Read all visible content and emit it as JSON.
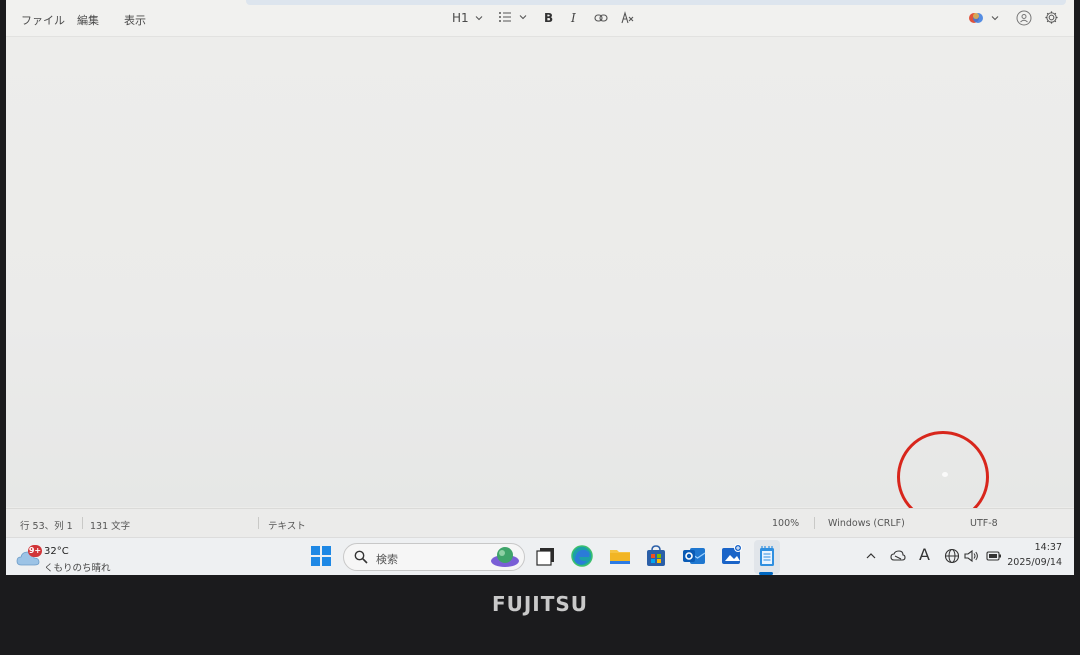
{
  "menu": {
    "file": "ファイル",
    "edit": "編集",
    "view": "表示"
  },
  "toolbar": {
    "heading": "H1",
    "bold": "B",
    "italic": "I",
    "icons": [
      "list-icon",
      "bold-icon",
      "italic-icon",
      "link-icon",
      "clear-formatting-icon",
      "copilot-icon",
      "account-icon",
      "settings-icon"
    ]
  },
  "status": {
    "position": "行 53、列 1",
    "char_count": "131 文字",
    "format": "テキスト",
    "zoom": "100%",
    "line_ending": "Windows (CRLF)",
    "encoding": "UTF-8"
  },
  "taskbar": {
    "weather": {
      "badge": "9+",
      "temp": "32°C",
      "condition": "くもりのち晴れ"
    },
    "search_placeholder": "検索",
    "clock": {
      "time": "14:37",
      "date": "2025/09/14"
    },
    "tray_ime": "A",
    "apps": [
      "start-icon",
      "search-box",
      "widget-icon",
      "task-view-icon",
      "edge-icon",
      "file-explorer-icon",
      "store-icon",
      "outlook-icon",
      "photos-icon",
      "notepad-icon"
    ]
  },
  "bezel": {
    "brand": "FUJITSU"
  },
  "colors": {
    "accent": "#0067c0",
    "annotation_ring": "#d8261c"
  }
}
